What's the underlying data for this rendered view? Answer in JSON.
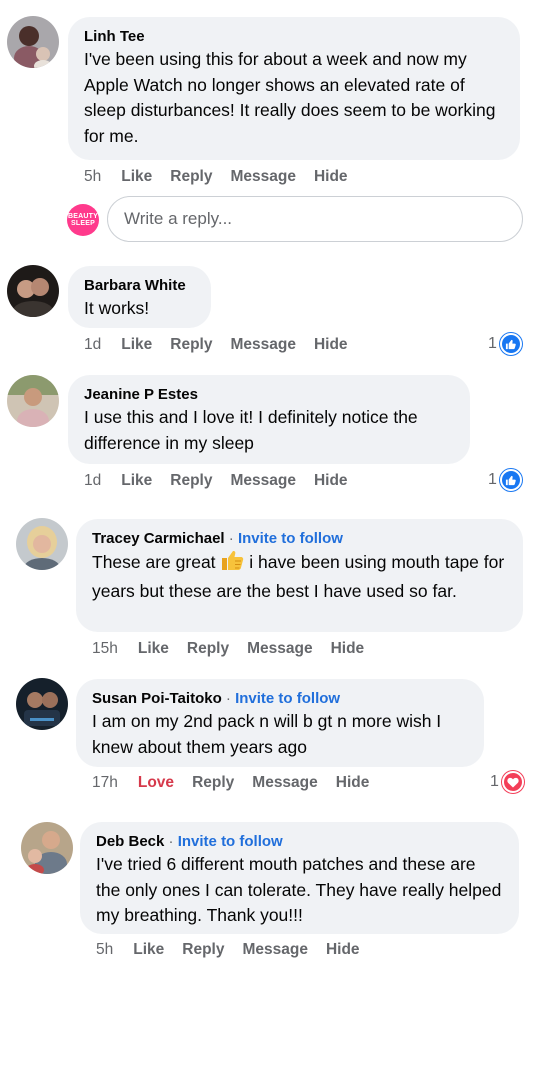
{
  "comments": [
    {
      "author": "Linh Tee",
      "invite": "",
      "text": "I've been using this for about a week and now my Apple Watch no longer shows an elevated rate of sleep disturbances!  It really does seem to be working for me.",
      "time": "5h",
      "like": "Like",
      "reply": "Reply",
      "message": "Message",
      "hide": "Hide",
      "reactions": ""
    },
    {
      "author": "Barbara White",
      "invite": "",
      "text": "It works!",
      "time": "1d",
      "like": "Like",
      "reply": "Reply",
      "message": "Message",
      "hide": "Hide",
      "reactions": "1"
    },
    {
      "author": "Jeanine P Estes",
      "invite": "",
      "text": "I use this and I love it! I definitely notice the difference in my sleep",
      "time": "1d",
      "like": "Like",
      "reply": "Reply",
      "message": "Message",
      "hide": "Hide",
      "reactions": "1"
    },
    {
      "author": "Tracey Carmichael",
      "invite": "Invite to follow",
      "text_before_emoji": "These are great",
      "text_after_emoji": "i have been using mouth tape for years but these are the best I have used so far.",
      "time": "15h",
      "like": "Like",
      "reply": "Reply",
      "message": "Message",
      "hide": "Hide",
      "reactions": ""
    },
    {
      "author": "Susan Poi-Taitoko",
      "invite": "Invite to follow",
      "text": "I am on my 2nd pack n will b gt n more wish I knew about them years ago",
      "time": "17h",
      "like": "Love",
      "reply": "Reply",
      "message": "Message",
      "hide": "Hide",
      "reactions": "1"
    },
    {
      "author": "Deb Beck",
      "invite": "Invite to follow",
      "text": "I've tried 6 different mouth patches and these are the only ones I can tolerate.  They have really helped my breathing.  Thank you!!!",
      "time": "5h",
      "like": "Like",
      "reply": "Reply",
      "message": "Message",
      "hide": "Hide",
      "reactions": ""
    }
  ],
  "reply_box": {
    "placeholder": "Write a reply...",
    "avatar_label": "BEAUTY SLEEP"
  },
  "dot_separator": "·",
  "colors": {
    "bubble": "#f0f2f5",
    "link": "#216fdb",
    "like_blue": "#1877f2",
    "love_red": "#f33e58"
  }
}
